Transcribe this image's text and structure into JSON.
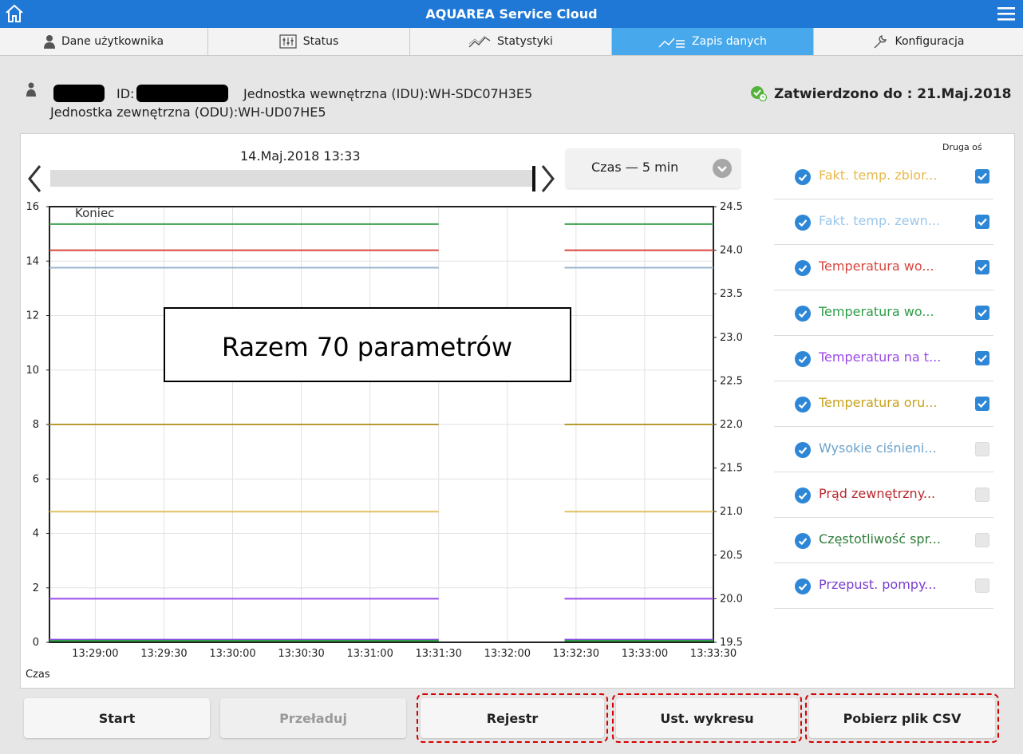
{
  "header": {
    "title": "AQUAREA Service Cloud",
    "home_icon": "home-icon",
    "menu_icon": "hamburger-menu-icon"
  },
  "tabs": [
    {
      "label": "Dane użytkownika",
      "icon": "user-icon",
      "active": false
    },
    {
      "label": "Status",
      "icon": "status-sliders-icon",
      "active": false
    },
    {
      "label": "Statystyki",
      "icon": "statistics-chart-icon",
      "active": false
    },
    {
      "label": "Zapis danych",
      "icon": "data-log-icon",
      "active": true
    },
    {
      "label": "Konfiguracja",
      "icon": "wrench-icon",
      "active": false
    }
  ],
  "info": {
    "id_label": "ID:",
    "idu": "Jednostka wewnętrzna (IDU):WH-SDC07H3E5",
    "odu": "Jednostka zewnętrzna (ODU):WH-UD07HE5",
    "confirmed": "Zatwierdzono do : 21.Maj.2018"
  },
  "chart_nav": {
    "timestamp": "14.Maj.2018 13:33",
    "time_select": "Czas — 5 min"
  },
  "legend": {
    "header": "Druga oś",
    "items": [
      {
        "label": "Fakt. temp. zbior...",
        "color": "#e8b84a",
        "second_axis": true
      },
      {
        "label": "Fakt. temp. zewn...",
        "color": "#9cc7ea",
        "second_axis": true
      },
      {
        "label": "Temperatura wo...",
        "color": "#d9463f",
        "second_axis": true
      },
      {
        "label": "Temperatura wo...",
        "color": "#2e9e48",
        "second_axis": true
      },
      {
        "label": "Temperatura na t...",
        "color": "#9a4ae8",
        "second_axis": true
      },
      {
        "label": "Temperatura oru...",
        "color": "#c9a21a",
        "second_axis": true
      },
      {
        "label": "Wysokie ciśnieni...",
        "color": "#6ba3cc",
        "second_axis": false
      },
      {
        "label": "Prąd zewnętrzny...",
        "color": "#b8292e",
        "second_axis": false
      },
      {
        "label": "Częstotliwość spr...",
        "color": "#2f7d3a",
        "second_axis": false
      },
      {
        "label": "Przepust. pompy...",
        "color": "#7a3fd0",
        "second_axis": false
      }
    ]
  },
  "chart_data": {
    "type": "line",
    "annotation": "Koniec",
    "callout": "Razem 70 parametrów",
    "xlabel": "Czas",
    "x_ticks": [
      "13:29:00",
      "13:29:30",
      "13:30:00",
      "13:30:30",
      "13:31:00",
      "13:31:30",
      "13:32:00",
      "13:32:30",
      "13:33:00",
      "13:33:30"
    ],
    "x_range": [
      "13:28:40",
      "13:33:30"
    ],
    "gap": [
      "13:31:30",
      "13:32:25"
    ],
    "y_left": {
      "range": [
        0,
        16
      ],
      "ticks": [
        0,
        2,
        4,
        6,
        8,
        10,
        12,
        14,
        16
      ]
    },
    "y_right": {
      "range": [
        19.5,
        24.5
      ],
      "ticks": [
        19.5,
        20.0,
        20.5,
        21.0,
        21.5,
        22.0,
        22.5,
        23.0,
        23.5,
        24.0,
        24.5
      ]
    },
    "grid": true,
    "series": [
      {
        "axis": "right",
        "color": "#3ea14e",
        "value": 24.3
      },
      {
        "axis": "right",
        "color": "#d9463f",
        "value": 24.0
      },
      {
        "axis": "right",
        "color": "#9ab6cf",
        "value": 23.8
      },
      {
        "axis": "left",
        "color": "#b89a32",
        "value": 8.0
      },
      {
        "axis": "left",
        "color": "#e0c060",
        "value": 4.8
      },
      {
        "axis": "left",
        "color": "#9a4ae8",
        "value": 1.6
      },
      {
        "axis": "left",
        "color": "#8a55e0",
        "value": 0.1
      },
      {
        "axis": "left",
        "color": "#2e9e48",
        "value": 0.0
      }
    ]
  },
  "buttons": {
    "start": "Start",
    "reload": "Przeładuj",
    "register": "Rejestr",
    "chart_settings": "Ust. wykresu",
    "download_csv": "Pobierz plik CSV"
  }
}
